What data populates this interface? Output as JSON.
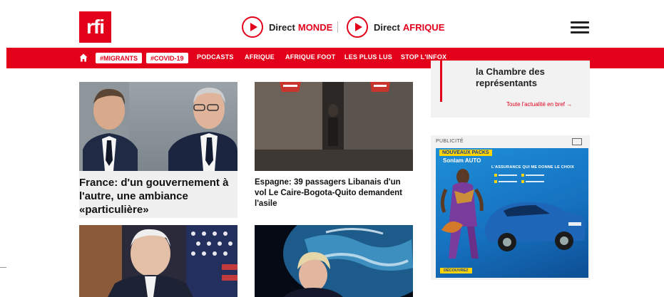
{
  "header": {
    "logo_text": "rfi",
    "live": [
      {
        "label": "Direct",
        "region": "MONDE"
      },
      {
        "label": "Direct",
        "region": "AFRIQUE"
      }
    ]
  },
  "nav": {
    "tags": [
      "#MIGRANTS",
      "#COVID-19"
    ],
    "links": [
      "PODCASTS",
      "AFRIQUE",
      "AFRIQUE FOOT",
      "LES PLUS LUS",
      "STOP L'INFOX"
    ]
  },
  "articles": [
    {
      "headline": "France: d'un gouvernement à l'autre, une ambiance «particulière»"
    },
    {
      "headline": "Espagne: 39 passagers Libanais d'un vol Le Caire-Bogota-Quito demandent l'asile"
    }
  ],
  "brief": {
    "text": "la Chambre des représentants",
    "more": "Toute l'actualité en bref →"
  },
  "ad": {
    "label": "PUBLICITÉ",
    "pack": "NOUVEAUX PACKS",
    "brand": "Sonlam AUTO",
    "slogan": "L'ASSURANCE QUI ME DONNE LE CHOIX",
    "cta": "DÉCOUVREZ"
  },
  "colors": {
    "brand_red": "#e3001b",
    "ad_blue": "#1672c0",
    "ad_yellow": "#ffd400"
  }
}
